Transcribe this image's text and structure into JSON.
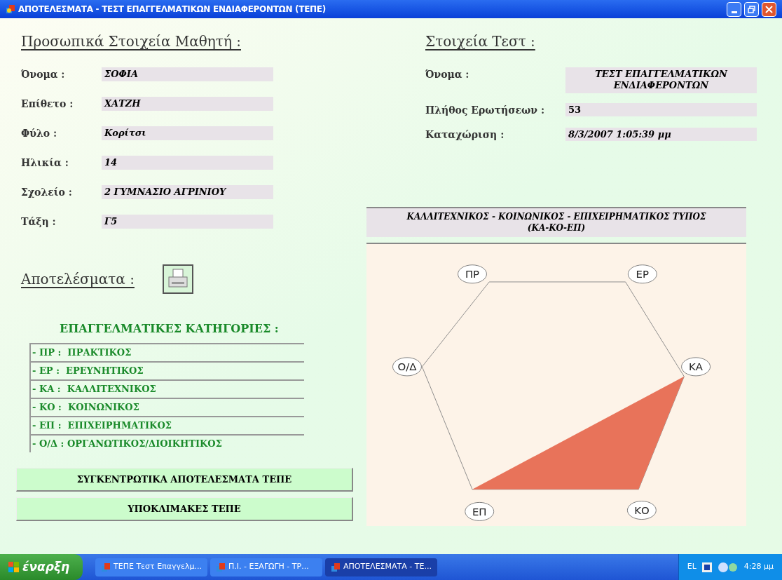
{
  "window": {
    "title": "ΑΠΟΤΕΛΕΣΜΑΤΑ - ΤΕΣΤ ΕΠΑΓΓΕΛΜΑΤΙΚΩΝ ΕΝΔΙΑΦΕΡΟΝΤΩΝ (ΤΕΠΕ)"
  },
  "student": {
    "heading": "Προσωπικά Στοιχεία Μαθητή :",
    "fields": [
      {
        "label": "Όνομα :",
        "value": "ΣΟΦΙΑ"
      },
      {
        "label": "Επίθετο :",
        "value": "ΧΑΤΖΗ"
      },
      {
        "label": "Φύλο :",
        "value": "Κορίτσι"
      },
      {
        "label": "Ηλικία :",
        "value": "14"
      },
      {
        "label": "Σχολείο :",
        "value": "2 ΓΥΜΝΑΣΙΟ ΑΓΡΙΝΙΟΥ"
      },
      {
        "label": "Τάξη :",
        "value": "Γ5"
      }
    ]
  },
  "test": {
    "heading": "Στοιχεία Τεστ :",
    "fields": [
      {
        "label": "Όνομα :",
        "value": "ΤΕΣΤ ΕΠΑΓΓΕΛΜΑΤΙΚΩΝ ΕΝΔΙΑΦΕΡΟΝΤΩΝ",
        "kind": "centered"
      },
      {
        "label": "Πλήθος Ερωτήσεων :",
        "value": "53",
        "kind": "plain"
      },
      {
        "label": "Καταχώριση :",
        "value": "8/3/2007 1:05:39 μμ",
        "kind": "italic"
      }
    ]
  },
  "results": {
    "heading": "Αποτελέσματα :"
  },
  "categories": {
    "title": "ΕΠΑΓΓΕΛΜΑΤΙΚΕΣ ΚΑΤΗΓΟΡΙΕΣ :",
    "items": [
      "- ΠΡ :  ΠΡΑΚΤΙΚΟΣ",
      "- ΕΡ :  ΕΡΕΥΝΗΤΙΚΟΣ",
      "- ΚΑ :  ΚΑΛΛΙΤΕΧΝΙΚΟΣ",
      "- ΚΟ :  ΚΟΙΝΩΝΙΚΟΣ",
      "- ΕΠ :  ΕΠΙΧΕΙΡΗΜΑΤΙΚΟΣ",
      "- Ο/Δ : ΟΡΓΑΝΩΤΙΚΟΣ/ΔΙΟΙΚΗΤΙΚΟΣ"
    ]
  },
  "buttons": [
    "ΣΥΓΚΕΝΤΡΩΤΙΚΑ ΑΠΟΤΕΛΕΣΜΑΤΑ ΤΕΠΕ",
    "ΥΠΟΚΛΙΜΑΚΕΣ ΤΕΠΕ"
  ],
  "profile": {
    "title": "ΚΑΛΛΙΤΕΧΝΙΚΟΣ - ΚΟΙΝΩΝΙΚΟΣ - ΕΠΙΧΕΙΡΗΜΑΤΙΚΟΣ ΤΥΠΟΣ\n(ΚΑ-ΚΟ-ΕΠ)",
    "vertices": [
      "ΠΡ",
      "ΕΡ",
      "ΚΑ",
      "ΚΟ",
      "ΕΠ",
      "Ο/Δ"
    ]
  },
  "taskbar": {
    "start": "έναρξη",
    "tasks": [
      {
        "label": "ΤΕΠΕ Τεστ Επαγγελμ...",
        "selected": false
      },
      {
        "label": "Π.Ι. - ΕΞΑΓΩΓΗ - ΤΡ...",
        "selected": false
      },
      {
        "label": "ΑΠΟΤΕΛΕΣΜΑΤΑ - ΤΕ...",
        "selected": true
      }
    ],
    "language": "EL",
    "clock": "4:28 μμ"
  }
}
